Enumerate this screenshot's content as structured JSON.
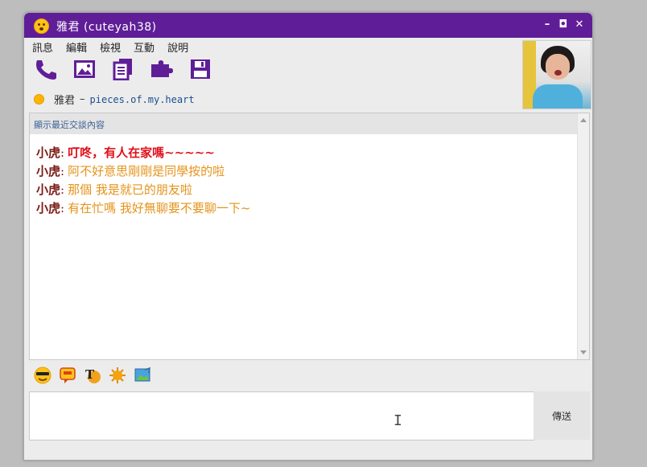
{
  "titlebar": {
    "title": "雅君 (cuteyah38)",
    "minimize": "–",
    "maximize": "◘",
    "close": "✕"
  },
  "menu": [
    "訊息",
    "編輯",
    "檢視",
    "互動",
    "說明"
  ],
  "toolbar_icons": [
    "phone-icon",
    "photo-icon",
    "documents-icon",
    "puzzle-icon",
    "save-icon"
  ],
  "status": {
    "name": "雅君",
    "separator": "–",
    "message": "pieces.of.my.heart"
  },
  "chat": {
    "history_label": "顯示最近交談內容",
    "messages": [
      {
        "sender": "小虎",
        "colon": ":",
        "text": "叮咚，有人在家嗎~~~~~",
        "color": "#e0101a",
        "bold": true
      },
      {
        "sender": "小虎",
        "colon": ":",
        "text": "阿不好意思剛剛是同學按的啦",
        "color": "#e4931a"
      },
      {
        "sender": "小虎",
        "colon": ":",
        "text": "那個 我是就已的朋友啦",
        "color": "#e4931a"
      },
      {
        "sender": "小虎",
        "colon": ":",
        "text": "有在忙嗎 我好無聊要不要聊一下~",
        "color": "#e4931a"
      }
    ]
  },
  "emoticons": [
    "sunglasses-emoticon-icon",
    "speech-emoticon-icon",
    "font-style-icon",
    "sun-emoticon-icon",
    "image-emoticon-icon"
  ],
  "input": {
    "value": ""
  },
  "send_button": {
    "label": "傳送"
  },
  "colors": {
    "titlebar": "#5f1e97",
    "toolbar_icon": "#5f1e97"
  }
}
